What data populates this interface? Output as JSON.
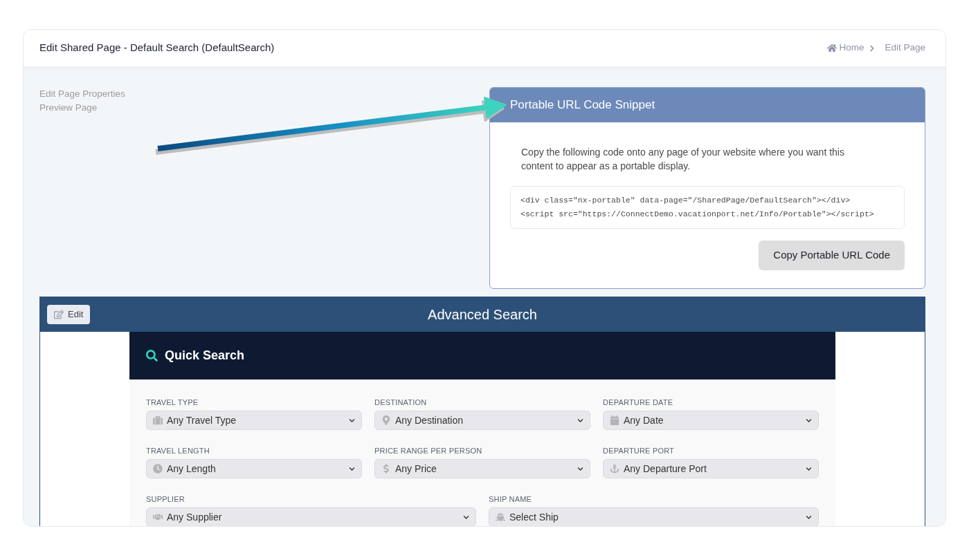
{
  "header": {
    "title": "Edit Shared Page - Default Search (DefaultSearch)",
    "breadcrumb": [
      {
        "label": "Home",
        "kind": "home"
      },
      {
        "label": "Edit Page",
        "kind": "current"
      }
    ]
  },
  "side_links": [
    "Edit Page Properties",
    "Preview Page"
  ],
  "snippet_card": {
    "title": "Portable URL Code Snippet",
    "description": "Copy the following code onto any page of your website where you want this content to appear as a portable display.",
    "code_lines": [
      "<div class=\"nx-portable\" data-page=\"/SharedPage/DefaultSearch\"></div>",
      "<script src=\"https://ConnectDemo.vacationport.net/Info/Portable\"></script>"
    ],
    "button": "Copy Portable URL Code"
  },
  "advanced_search": {
    "edit_button": "Edit",
    "title": "Advanced Search",
    "quick_search": {
      "title": "Quick Search",
      "rows": [
        {
          "fields": [
            {
              "label": "TRAVEL TYPE",
              "value": "Any Travel Type",
              "kind": "travel-type"
            },
            {
              "label": "DESTINATION",
              "value": "Any Destination",
              "kind": "destination"
            },
            {
              "label": "DEPARTURE DATE",
              "value": "Any Date",
              "kind": "date"
            }
          ]
        },
        {
          "fields": [
            {
              "label": "TRAVEL LENGTH",
              "value": "Any Length",
              "kind": "length"
            },
            {
              "label": "PRICE RANGE PER PERSON",
              "value": "Any Price",
              "kind": "price"
            },
            {
              "label": "DEPARTURE PORT",
              "value": "Any Departure Port",
              "kind": "port"
            }
          ]
        },
        {
          "fields": [
            {
              "label": "SUPPLIER",
              "value": "Any Supplier",
              "kind": "supplier"
            },
            {
              "label": "SHIP NAME",
              "value": "Select Ship",
              "kind": "ship"
            }
          ]
        }
      ]
    }
  }
}
